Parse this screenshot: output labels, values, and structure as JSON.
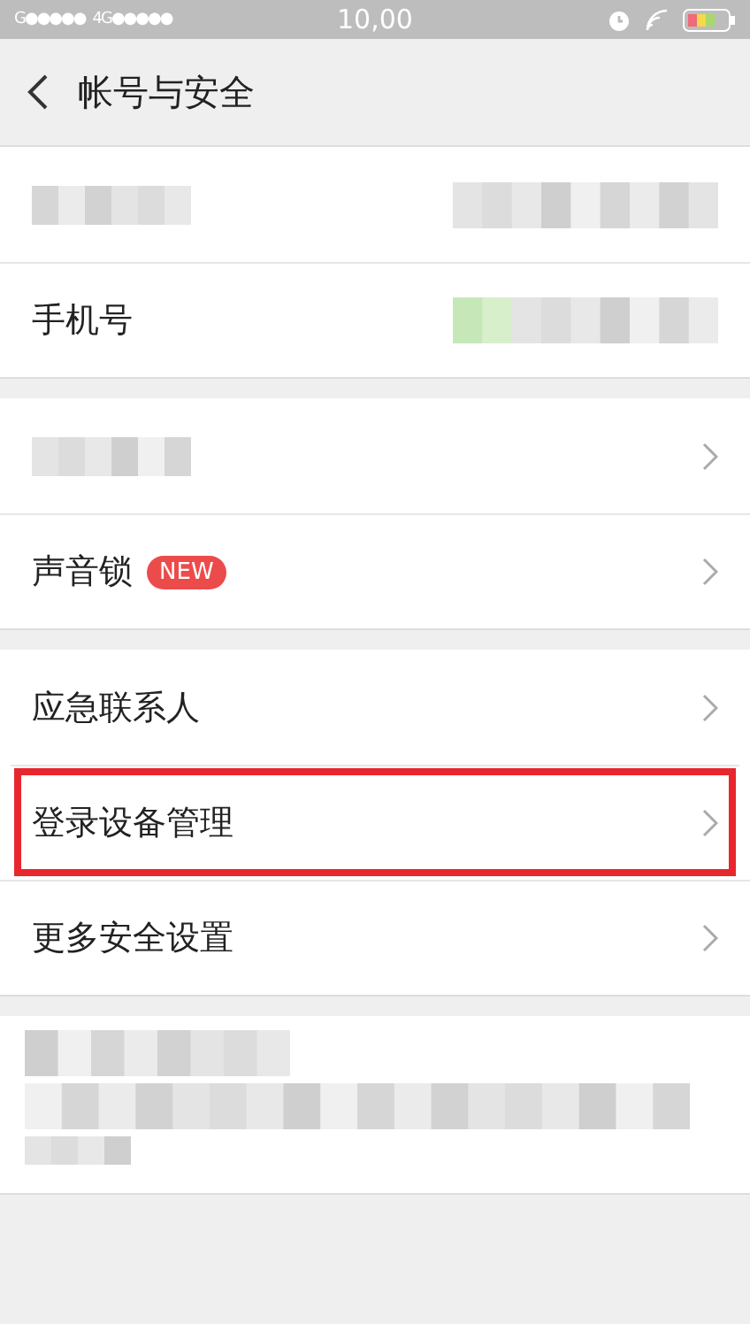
{
  "status_bar": {
    "carrier_1": "G●●●●●",
    "carrier_2": "4G●●●●●",
    "time": "10,00"
  },
  "header": {
    "title": "帐号与安全"
  },
  "sections": [
    {
      "kind": "rows",
      "rows": [
        {
          "label_redacted": true,
          "value_redacted": true,
          "chevron": false,
          "highlighted": false
        },
        {
          "label": "手机号",
          "label_redacted": false,
          "value_redacted": true,
          "chevron": false,
          "highlighted": false
        }
      ]
    },
    {
      "kind": "rows",
      "rows": [
        {
          "label_redacted": true,
          "value_redacted": false,
          "chevron": true,
          "highlighted": false
        },
        {
          "label": "声音锁",
          "badge": "NEW",
          "label_redacted": false,
          "value_redacted": false,
          "chevron": true,
          "highlighted": false
        }
      ]
    },
    {
      "kind": "rows",
      "rows": [
        {
          "label": "应急联系人",
          "label_redacted": false,
          "value_redacted": false,
          "chevron": true,
          "highlighted": false
        },
        {
          "label": "登录设备管理",
          "label_redacted": false,
          "value_redacted": false,
          "chevron": true,
          "highlighted": true
        },
        {
          "label": "更多安全设置",
          "label_redacted": false,
          "value_redacted": false,
          "chevron": true,
          "highlighted": false
        }
      ]
    },
    {
      "kind": "note"
    }
  ]
}
